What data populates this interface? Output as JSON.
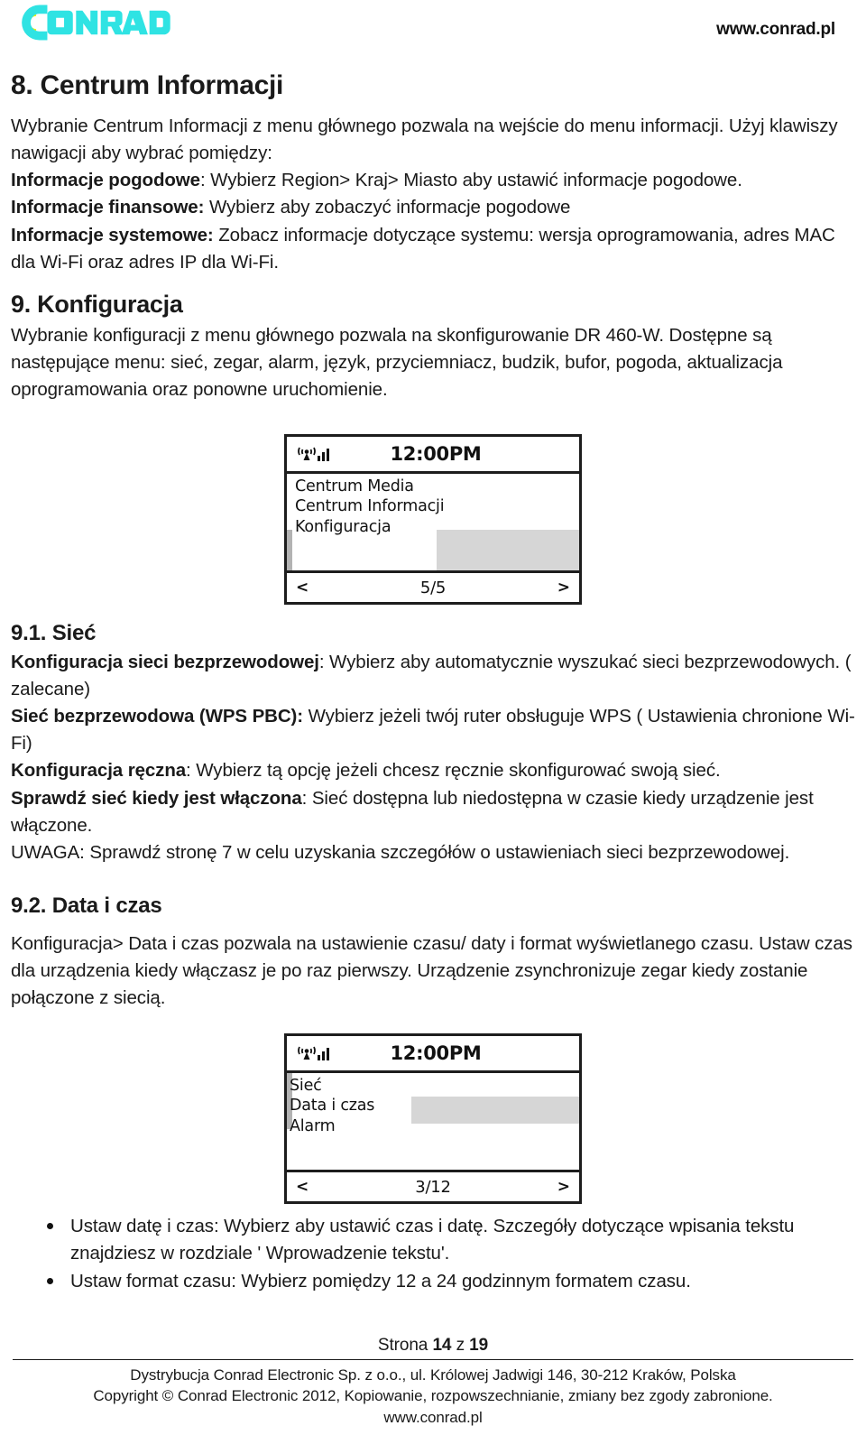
{
  "header": {
    "logo_text": "CONRAD",
    "logo_colors": {
      "outer": "#2fe3e3",
      "inner": "#f2f200"
    },
    "site_url": "www.conrad.pl"
  },
  "sections": {
    "s8": {
      "heading": "8. Centrum Informacji",
      "para_1": "Wybranie Centrum Informacji z menu głównego pozwala na wejście do menu informacji. Użyj klawiszy nawigacji aby wybrać pomiędzy:",
      "line_weather_label": "Informacje pogodowe",
      "line_weather_text": ": Wybierz Region> Kraj> Miasto aby ustawić informacje pogodowe.",
      "line_finance_label": "Informacje finansowe:",
      "line_finance_text": " Wybierz aby zobaczyć informacje pogodowe",
      "line_system_label": "Informacje systemowe:",
      "line_system_text": " Zobacz informacje dotyczące systemu: wersja oprogramowania, adres MAC dla Wi-Fi oraz adres IP dla Wi-Fi."
    },
    "s9": {
      "heading": "9. Konfiguracja",
      "para_1": "Wybranie konfiguracji z menu głównego pozwala na skonfigurowanie DR 460-W. Dostępne są następujące menu: sieć, zegar, alarm, język, przyciemniacz, budzik, bufor, pogoda, aktualizacja oprogramowania oraz ponowne uruchomienie."
    },
    "s91": {
      "heading": "9.1. Sieć",
      "wifi_cfg_label": "Konfiguracja sieci bezprzewodowej",
      "wifi_cfg_text": ": Wybierz aby automatycznie wyszukać sieci bezprzewodowych. ( zalecane)",
      "wps_label": "Sieć bezprzewodowa (WPS PBC):",
      "wps_text": " Wybierz jeżeli twój ruter obsługuje WPS ( Ustawienia chronione Wi-Fi)",
      "manual_label": "Konfiguracja ręczna",
      "manual_text": ": Wybierz tą opcję jeżeli chcesz ręcznie skonfigurować swoją sieć.",
      "check_label": "Sprawdź sieć kiedy jest włączona",
      "check_text": ": Sieć dostępna lub niedostępna w czasie kiedy urządzenie jest włączone.",
      "note": "UWAGA: Sprawdź stronę 7 w celu uzyskania szczegółów o ustawieniach sieci bezprzewodowej."
    },
    "s92": {
      "heading": "9.2. Data i czas",
      "para_1": "Konfiguracja> Data i czas pozwala na ustawienie czasu/ daty i format wyświetlanego czasu. Ustaw czas dla urządzenia kiedy włączasz je po raz pierwszy. Urządzenie zsynchronizuje zegar kiedy zostanie połączone z siecią.",
      "bullets": [
        "Ustaw datę i czas: Wybierz aby ustawić czas i datę. Szczegóły dotyczące wpisania tekstu znajdziesz w rozdziale ' Wprowadzenie tekstu'.",
        "Ustaw format czasu: Wybierz pomiędzy 12 a 24 godzinnym formatem czasu."
      ]
    }
  },
  "lcd_1": {
    "clock": "12:00PM",
    "menu_items": [
      "Centrum Media",
      "Centrum Informacji",
      "Konfiguracja"
    ],
    "nav_prev": "<",
    "nav_next": ">",
    "page_indicator": "5/5",
    "highlight_color": "#d6d6d6",
    "scrollbar_color": "#b3b3b3"
  },
  "lcd_2": {
    "clock": "12:00PM",
    "menu_items": [
      "Sieć",
      "Data i czas",
      "Alarm"
    ],
    "nav_prev": "<",
    "nav_next": ">",
    "page_indicator": "3/12",
    "highlight_color": "#d6d6d6",
    "scrollbar_color": "#b3b3b3"
  },
  "footer": {
    "page_label_prefix": "Strona ",
    "page_current": "14",
    "page_mid": " z ",
    "page_total": "19",
    "line_1": "Dystrybucja Conrad Electronic Sp. z o.o., ul. Królowej Jadwigi 146, 30-212 Kraków, Polska",
    "line_2": "Copyright © Conrad Electronic 2012, Kopiowanie, rozpowszechnianie, zmiany bez zgody zabronione.",
    "line_3": "www.conrad.pl"
  }
}
